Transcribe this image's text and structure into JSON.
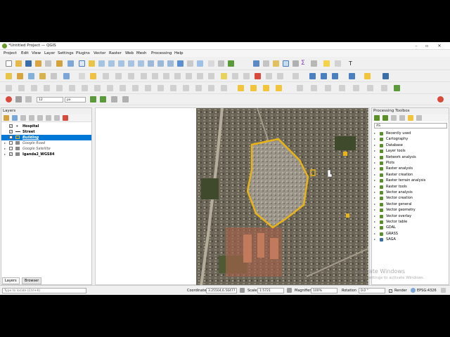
{
  "window": {
    "title": "*Untitled Project — QGIS",
    "min": "–",
    "max": "▫",
    "close": "✕"
  },
  "menu": [
    "Project",
    "Edit",
    "View",
    "Layer",
    "Settings",
    "Plugins",
    "Vector",
    "Raster",
    "Web",
    "Mesh",
    "Processing",
    "Help"
  ],
  "digitize": {
    "size_value": "12",
    "unit_value": "px"
  },
  "layers_panel": {
    "title": "Layers",
    "items": [
      {
        "label": "Hospital",
        "checked": true,
        "bold": true,
        "italic": false
      },
      {
        "label": "Street",
        "checked": true,
        "bold": true,
        "italic": false
      },
      {
        "label": "Building",
        "checked": true,
        "bold": true,
        "italic": true,
        "selected": true
      },
      {
        "label": "Google Road",
        "checked": false,
        "bold": false,
        "italic": true
      },
      {
        "label": "Google Satellite",
        "checked": false,
        "bold": false,
        "italic": true
      },
      {
        "label": "Iganda2_WGS84",
        "checked": true,
        "bold": true,
        "italic": false
      }
    ],
    "tabs": [
      "Layers",
      "Browser"
    ]
  },
  "toolbox": {
    "title": "Processing Toolbox",
    "search_value": "AS",
    "items": [
      "Recently used",
      "Cartography",
      "Database",
      "Layer tools",
      "Network analysis",
      "Plots",
      "Raster analysis",
      "Raster creation",
      "Raster terrain analysis",
      "Raster tools",
      "Vector analysis",
      "Vector creation",
      "Vector general",
      "Vector geometry",
      "Vector overlay",
      "Vector table",
      "GDAL",
      "GRASS",
      "SAGA"
    ]
  },
  "status": {
    "search_placeholder": "Type to locate (Ctrl+K)",
    "coordinate_label": "Coordinate",
    "coordinate_value": "3.25504,6.56477",
    "scale_label": "Scale",
    "scale_value": "1:5721",
    "magnifier_label": "Magnifier",
    "magnifier_value": "100%",
    "rotation_label": "Rotation",
    "rotation_value": "0.0 °",
    "render_label": "Render",
    "crs_label": "EPSG:4326"
  },
  "watermark": {
    "line1": "Activate Windows",
    "line2": "Go to Settings to activate Windows."
  },
  "colors": {
    "selection": "#0078d7",
    "boundary": "#e8b318",
    "accent": "#5b8f29"
  }
}
